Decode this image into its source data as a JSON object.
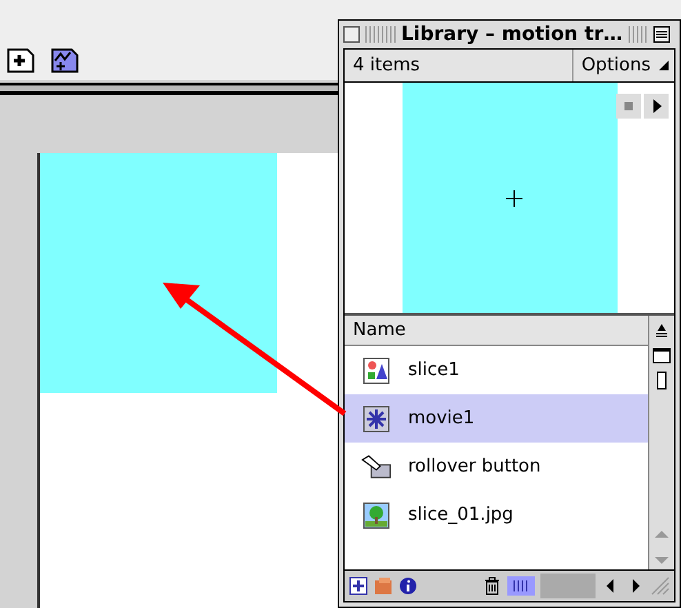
{
  "library": {
    "title": "Library – motion tr…",
    "item_count": "4 items",
    "options": "Options",
    "column": "Name",
    "items": [
      {
        "name": "slice1",
        "kind": "graphic",
        "selected": false
      },
      {
        "name": "movie1",
        "kind": "movie",
        "selected": true
      },
      {
        "name": "rollover button",
        "kind": "button",
        "selected": false
      },
      {
        "name": "slice_01.jpg",
        "kind": "bitmap",
        "selected": false
      }
    ]
  }
}
